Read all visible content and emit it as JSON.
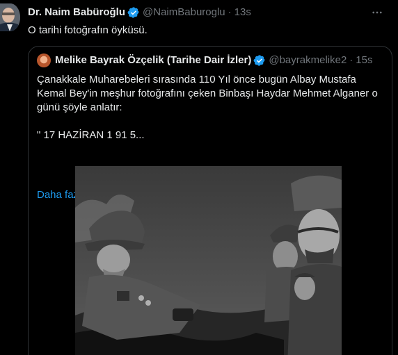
{
  "post": {
    "author_name": "Dr. Naim Babüroğlu",
    "handle": "@NaimBaburoglu",
    "separator": "·",
    "time": "13s",
    "text": "O tarihi fotoğrafın öyküsü."
  },
  "quoted": {
    "author_name": "Melike Bayrak Özçelik (Tarihe Dair İzler)",
    "handle": "@bayrakmelike2",
    "separator": "·",
    "time": "15s",
    "text_line1": "Çanakkale Muharebeleri sırasında 110 Yıl önce bugün Albay Mustafa Kemal Bey'in meşhur fotoğrafını çeken Binbaşı Haydar Mehmet Alganer o günü şöyle anlatır:",
    "text_line2": "\" 17 HAZİRAN 1 91 5...",
    "show_more": "Daha fazla göster"
  },
  "colors": {
    "background": "#000000",
    "text_primary": "#e7e9ea",
    "text_secondary": "#71767b",
    "link": "#1d9bf0",
    "verified": "#1d9bf0",
    "border": "#2f3336"
  },
  "icons": {
    "verified": "verified-badge-icon",
    "more": "more-options-icon"
  }
}
